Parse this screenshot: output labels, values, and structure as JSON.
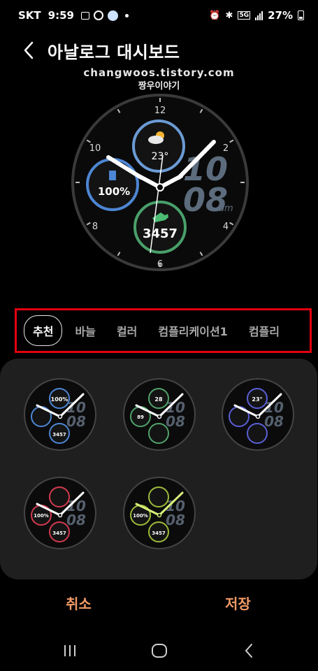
{
  "status_bar": {
    "carrier": "SKT",
    "time": "9:59",
    "network": "5G",
    "battery": "27%"
  },
  "header": {
    "title": "아날로그 대시보드"
  },
  "watermark": {
    "line1": "changwoos.tistory.com",
    "line2": "짱우이야기"
  },
  "preview": {
    "numerals": [
      "12",
      "2",
      "4",
      "6",
      "8",
      "10"
    ],
    "time_hour": "10",
    "time_minute": "08",
    "am_pm": "am",
    "weather_temp": "23°",
    "battery": "100%",
    "steps": "3457"
  },
  "tabs": [
    {
      "label": "추천",
      "active": true
    },
    {
      "label": "바늘",
      "active": false
    },
    {
      "label": "컬러",
      "active": false
    },
    {
      "label": "컴플리케이션1",
      "active": false
    },
    {
      "label": "컴플리",
      "active": false
    }
  ],
  "presets": [
    {
      "hour": "10",
      "minute": "08",
      "top": "100%",
      "left": "",
      "bottom": "3457",
      "accent": "#4d86d4",
      "hand": "#ffffff"
    },
    {
      "hour": "10",
      "minute": "08",
      "top": "28",
      "left": "89",
      "bottom": "",
      "accent": "#4fa36a",
      "hand": "#ffffff"
    },
    {
      "hour": "10",
      "minute": "08",
      "top": "23°",
      "left": "",
      "bottom": "",
      "accent": "#5a5fd6",
      "hand": "#ffffff"
    },
    {
      "hour": "10",
      "minute": "08",
      "top": "",
      "left": "100%",
      "bottom": "3457",
      "accent": "#d23a4e",
      "hand": "#ffffff"
    },
    {
      "hour": "10",
      "minute": "08",
      "top": "",
      "left": "100%",
      "bottom": "3457",
      "accent": "#9dbb3a",
      "hand": "#d8ef7a"
    }
  ],
  "actions": {
    "cancel": "취소",
    "save": "저장"
  },
  "colors": {
    "accent": "#f19a67",
    "highlight_border": "#e3000f",
    "panel": "#1f1f1f"
  }
}
